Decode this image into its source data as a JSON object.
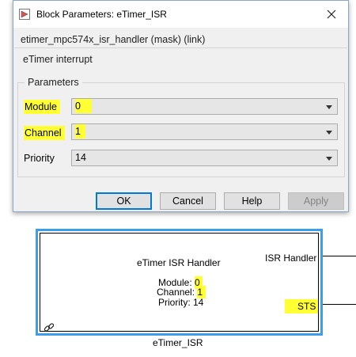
{
  "dialog": {
    "title": "Block Parameters: eTimer_ISR",
    "mask_header": "etimer_mpc574x_isr_handler (mask) (link)",
    "description": "eTimer interrupt",
    "group_title": "Parameters",
    "params": [
      {
        "label": "Module",
        "value": "0",
        "highlight": true
      },
      {
        "label": "Channel",
        "value": "1",
        "highlight": true
      },
      {
        "label": "Priority",
        "value": "14",
        "highlight": false
      }
    ],
    "buttons": {
      "ok": "OK",
      "cancel": "Cancel",
      "help": "Help",
      "apply": "Apply"
    }
  },
  "block": {
    "title": "eTimer ISR Handler",
    "module_label": "Module: ",
    "module_value": "0",
    "channel_label": "Channel: ",
    "channel_value": "1",
    "priority_text": "Priority: 14",
    "port_isr": "ISR Handler",
    "port_sts": "STS",
    "name": "eTimer_ISR"
  },
  "colors": {
    "highlight": "#ffff33",
    "block_selection": "#3a9ee8",
    "default_button_border": "#0078d7"
  },
  "icons": [
    "simulink-app-icon",
    "close-icon",
    "chevron-down-icon",
    "link-icon"
  ]
}
